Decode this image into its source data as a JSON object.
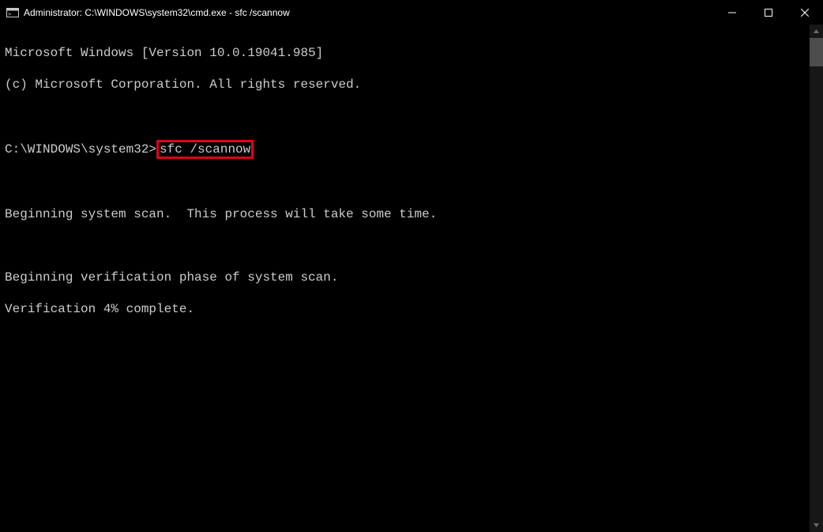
{
  "window": {
    "title": "Administrator: C:\\WINDOWS\\system32\\cmd.exe - sfc  /scannow"
  },
  "terminal": {
    "line_version": "Microsoft Windows [Version 10.0.19041.985]",
    "line_copyright": "(c) Microsoft Corporation. All rights reserved.",
    "prompt_path": "C:\\WINDOWS\\system32>",
    "command_text": "sfc /scannow",
    "line_beginscan": "Beginning system scan.  This process will take some time.",
    "line_verifphase": "Beginning verification phase of system scan.",
    "line_verifpct": "Verification 4% complete."
  },
  "icons": {
    "app": "cmd-icon",
    "minimize": "minimize-icon",
    "maximize": "maximize-icon",
    "close": "close-icon",
    "scroll_up": "scroll-up-icon",
    "scroll_down": "scroll-down-icon"
  }
}
